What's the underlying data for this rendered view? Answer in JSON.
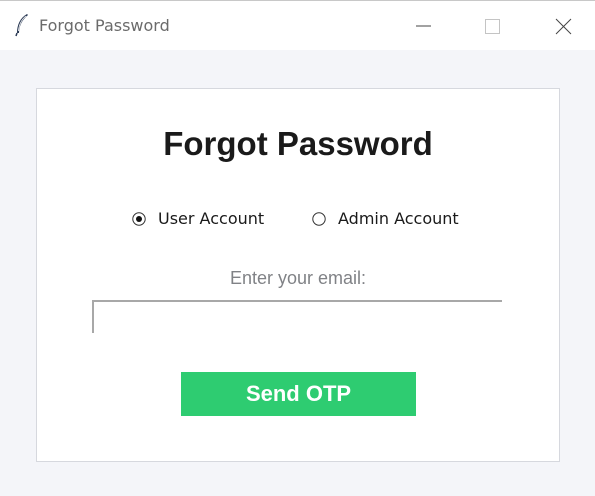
{
  "window": {
    "title": "Forgot Password",
    "app_icon": "feather-icon",
    "controls": {
      "minimize_icon": "minimize-icon",
      "maximize_icon": "maximize-icon",
      "close_icon": "close-icon"
    }
  },
  "form": {
    "heading": "Forgot Password",
    "account_type": {
      "options": [
        {
          "label": "User Account",
          "selected": true
        },
        {
          "label": "Admin Account",
          "selected": false
        }
      ]
    },
    "email_label": "Enter your email:",
    "email_value": "",
    "send_button_label": "Send OTP"
  },
  "colors": {
    "background": "#f4f5f9",
    "card": "#ffffff",
    "button": "#2ecc71",
    "button_text": "#ffffff",
    "label_gray": "#808286"
  }
}
